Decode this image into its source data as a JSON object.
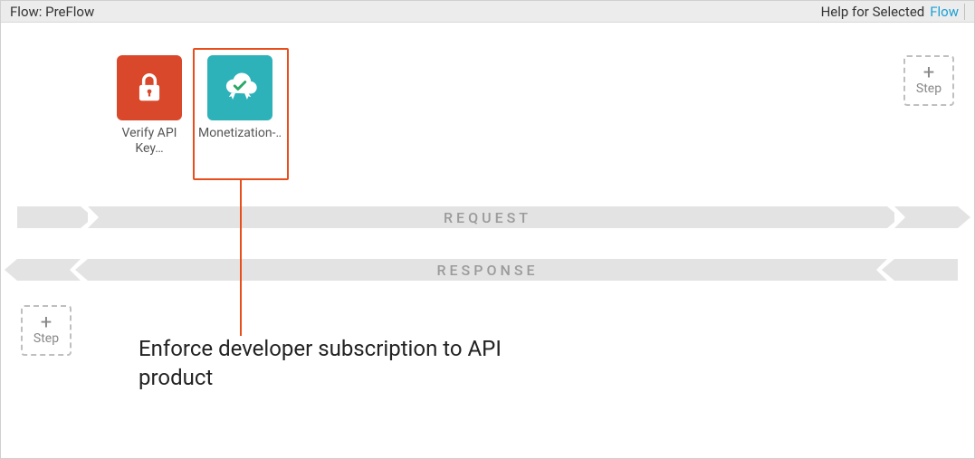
{
  "topbar": {
    "title": "Flow: PreFlow",
    "help_label": "Help for Selected",
    "flow_link": "Flow"
  },
  "policies": [
    {
      "label": "Verify API Key…",
      "icon": "lock-icon",
      "color": "red"
    },
    {
      "label": "Monetization-…",
      "icon": "cloud-check-icon",
      "color": "teal"
    }
  ],
  "lanes": {
    "request": "REQUEST",
    "response": "RESPONSE"
  },
  "step_button": {
    "plus": "+",
    "label": "Step"
  },
  "callout": "Enforce developer subscription to API product"
}
